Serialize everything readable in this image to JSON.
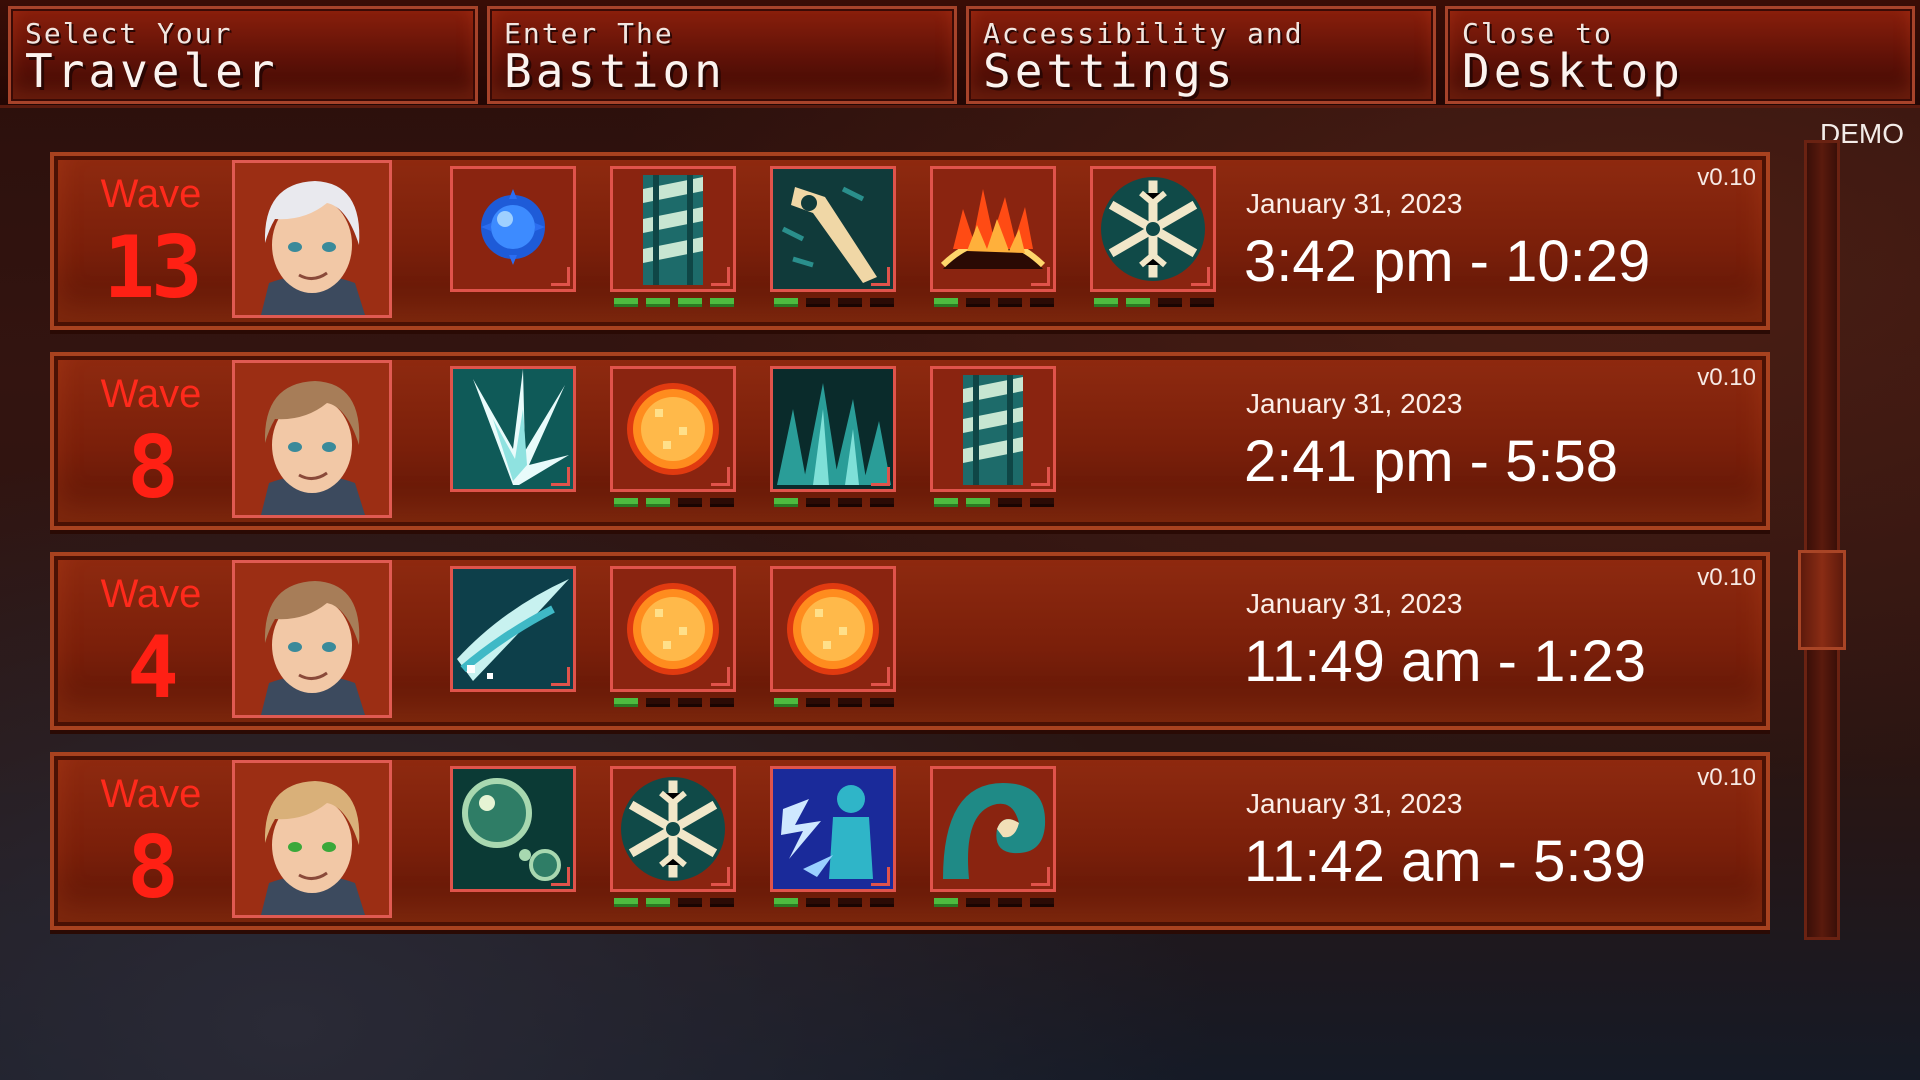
{
  "menu": [
    {
      "small": "Select Your",
      "big": "Traveler"
    },
    {
      "small": "Enter The",
      "big": "Bastion"
    },
    {
      "small": "Accessibility and",
      "big": "Settings"
    },
    {
      "small": "Close to",
      "big": "Desktop"
    }
  ],
  "demo_label": "DEMO",
  "runs": [
    {
      "wave_label": "Wave",
      "wave": "13",
      "date": "January 31, 2023",
      "time": "3:42 pm - 10:29",
      "version": "v0.10",
      "hero": "white-haired-hero",
      "abilities": [
        {
          "icon": "blue-orb-icon",
          "pips_on": -1
        },
        {
          "icon": "drill-pillar-icon",
          "pips_on": 4
        },
        {
          "icon": "key-blade-icon",
          "pips_on": 1
        },
        {
          "icon": "fire-ring-icon",
          "pips_on": 1
        },
        {
          "icon": "snowflake-icon",
          "pips_on": 2
        }
      ]
    },
    {
      "wave_label": "Wave",
      "wave": "8",
      "date": "January 31, 2023",
      "time": "2:41 pm - 5:58",
      "version": "v0.10",
      "hero": "brown-haired-hero",
      "abilities": [
        {
          "icon": "ice-burst-icon",
          "pips_on": -1
        },
        {
          "icon": "sun-orb-icon",
          "pips_on": 2
        },
        {
          "icon": "crystal-spikes-icon",
          "pips_on": 1
        },
        {
          "icon": "drill-pillar-icon",
          "pips_on": 2
        }
      ]
    },
    {
      "wave_label": "Wave",
      "wave": "4",
      "date": "January 31, 2023",
      "time": "11:49 am - 1:23",
      "version": "v0.10",
      "hero": "brown-haired-hero",
      "abilities": [
        {
          "icon": "wind-slash-icon",
          "pips_on": -1
        },
        {
          "icon": "sun-orb-icon",
          "pips_on": 1
        },
        {
          "icon": "sun-orb-icon",
          "pips_on": 1
        }
      ]
    },
    {
      "wave_label": "Wave",
      "wave": "8",
      "date": "January 31, 2023",
      "time": "11:42 am - 5:39",
      "version": "v0.10",
      "hero": "blonde-hero",
      "abilities": [
        {
          "icon": "bubbles-icon",
          "pips_on": -1
        },
        {
          "icon": "snowflake-icon",
          "pips_on": 2
        },
        {
          "icon": "lightning-figure-icon",
          "pips_on": 1
        },
        {
          "icon": "wave-icon",
          "pips_on": 1
        }
      ]
    }
  ],
  "colors": {
    "accent_red": "#ff2014",
    "pip_on": "#4dbb3f",
    "panel": "#7a1f0a",
    "icon_border": "#e0534b",
    "hair": {
      "white-haired-hero": "#e9e9ee",
      "brown-haired-hero": "#a77d58",
      "blonde-hero": "#d9b079"
    }
  }
}
